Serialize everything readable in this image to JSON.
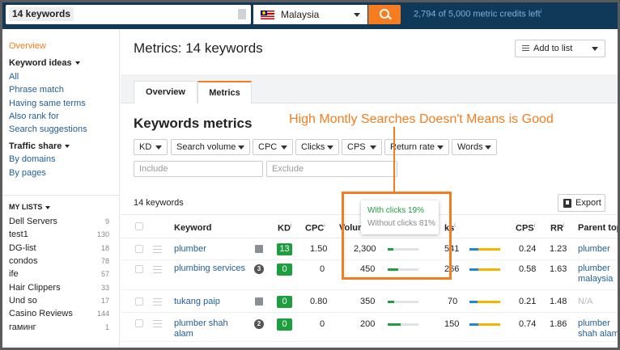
{
  "topbar": {
    "query": "14 keywords",
    "country": "Malaysia",
    "credits": "2,794 of 5,000 metric credits left",
    "credits_sup": "i"
  },
  "sidebar": {
    "overview": "Overview",
    "keyword_ideas": "Keyword ideas",
    "items": [
      "All",
      "Phrase match",
      "Having same terms",
      "Also rank for",
      "Search suggestions"
    ],
    "traffic_share": "Traffic share",
    "traffic_items": [
      "By domains",
      "By pages"
    ],
    "my_lists": "MY LISTS",
    "lists": [
      {
        "name": "Dell Servers",
        "count": "9"
      },
      {
        "name": "test1",
        "count": "130"
      },
      {
        "name": "DG-list",
        "count": "18"
      },
      {
        "name": "condos",
        "count": "78"
      },
      {
        "name": "ife",
        "count": "57"
      },
      {
        "name": "Hair Clippers",
        "count": "33"
      },
      {
        "name": "Und so",
        "count": "17"
      },
      {
        "name": "Casino Reviews",
        "count": "144"
      },
      {
        "name": "гаминг",
        "count": "1"
      }
    ]
  },
  "main": {
    "title_bold": "Metrics:",
    "title_rest": " 14 keywords",
    "add_to_list": "Add to list",
    "tabs": [
      "Overview",
      "Metrics"
    ],
    "section_title": "Keywords metrics",
    "annotation": "High Montly Searches Doesn't Means is Good",
    "filters": [
      "KD",
      "Search volume",
      "CPC",
      "Clicks",
      "CPS",
      "Return rate",
      "Words"
    ],
    "include_placeholder": "Include",
    "exclude_placeholder": "Exclude",
    "kw_count": "14 keywords",
    "export": "Export"
  },
  "table": {
    "headers": {
      "keyword": "Keyword",
      "kd": "KD",
      "cpc": "CPC",
      "volume": "Volum",
      "clicks": "ks",
      "cps": "CPS",
      "rr": "RR",
      "parent": "Parent topi"
    },
    "info_mark": "i",
    "rows": [
      {
        "keyword": "plumber",
        "serp": "image",
        "serp_num": "",
        "kd": "13",
        "cpc": "1.50",
        "volume": "2,300",
        "clicks_fill": 0.19,
        "clicks": "541",
        "rr_split": 0.72,
        "cps": "0.24",
        "rr": "1.23",
        "parent": "plumber"
      },
      {
        "keyword": "plumbing services",
        "serp": "num",
        "serp_num": "3",
        "kd": "0",
        "cpc": "0",
        "volume": "450",
        "clicks_fill": 0.33,
        "clicks": "266",
        "rr_split": 0.7,
        "cps": "0.58",
        "rr": "1.63",
        "parent": "plumber malaysia"
      },
      {
        "keyword": "tukang paip",
        "serp": "image",
        "serp_num": "",
        "kd": "0",
        "cpc": "0.80",
        "volume": "350",
        "clicks_fill": 0.2,
        "clicks": "70",
        "rr_split": 0.75,
        "cps": "0.21",
        "rr": "1.48",
        "parent": "N/A"
      },
      {
        "keyword": "plumber shah alam",
        "serp": "num",
        "serp_num": "2",
        "kd": "0",
        "cpc": "0",
        "volume": "200",
        "clicks_fill": 0.42,
        "clicks": "150",
        "rr_split": 0.7,
        "cps": "0.74",
        "rr": "1.86",
        "parent": "plumber shah alam"
      }
    ]
  },
  "tooltip": {
    "with_clicks": "With clicks 19%",
    "without_clicks": "Without clicks 81%"
  },
  "colors": {
    "accent": "#f57d20",
    "header": "#0f3859",
    "link": "#1f5e96",
    "green": "#1e9e3e"
  }
}
